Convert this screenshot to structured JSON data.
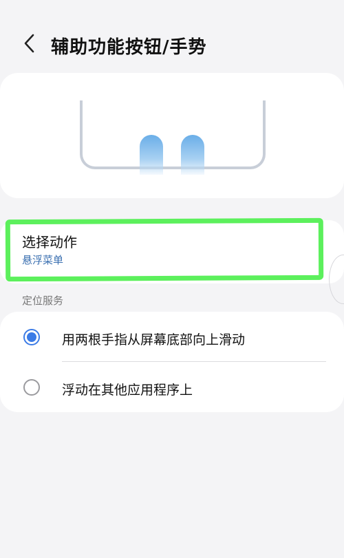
{
  "header": {
    "title": "辅助功能按钮/手势",
    "back_icon": "chevron-left-icon"
  },
  "preview": {
    "illustration": "two-finger-swipe-up-gesture",
    "accent_color": "#6aaee8"
  },
  "action": {
    "title": "选择动作",
    "value": "悬浮菜单",
    "value_color": "#3a6fb0"
  },
  "section": {
    "label": "定位服务"
  },
  "options": [
    {
      "label": "用两根手指从屏幕底部向上滑动",
      "selected": true
    },
    {
      "label": "浮动在其他应用程序上",
      "selected": false
    }
  ],
  "colors": {
    "background": "#f4f4f6",
    "card": "#ffffff",
    "radio_accent": "#3b7be6",
    "highlight": "#5cf05c"
  }
}
